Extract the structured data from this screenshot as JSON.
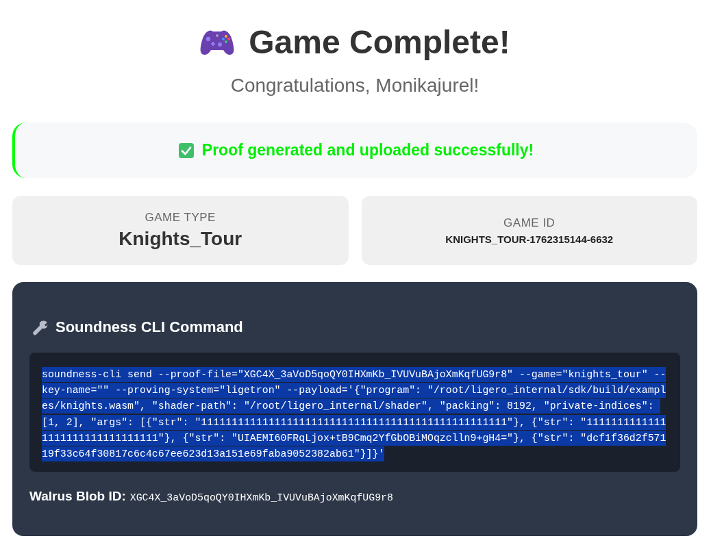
{
  "header": {
    "title": "Game Complete!",
    "subtitle": "Congratulations, Monikajurel!"
  },
  "status": {
    "kind": "success",
    "message": "Proof generated and uploaded successfully!"
  },
  "info_cards": [
    {
      "label": "GAME TYPE",
      "value": "Knights_Tour",
      "kind": "name"
    },
    {
      "label": "GAME ID",
      "value": "KNIGHTS_TOUR-1762315144-6632",
      "kind": "id"
    }
  ],
  "command_panel": {
    "title": "Soundness CLI Command",
    "command": {
      "text": "soundness-cli send --proof-file=\"XGC4X_3aVoD5qoQY0IHXmKb_IVUVuBAjoXmKqfUG9r8\" --game=\"knights_tour\" --key-name=\"\" --proving-system=\"ligetron\" --payload='{\"program\": \"/root/ligero_internal/sdk/build/examples/knights.wasm\", \"shader-path\": \"/root/ligero_internal/shader\", \"packing\": 8192, \"private-indices\": [1, 2], \"args\": [{\"str\": \"11111111111111111111111111111111111111111111111111\"}, {\"str\": \"11111111111111111111111111111111\"}, {\"str\": \"UIAEMI60FRqLjox+tB9Cmq2YfGbOBiMOqzclln9+gH4=\"}, {\"str\": \"dcf1f36d2f57119f33c64f30817c6c4c67ee623d13a151e69faba9052382ab61\"}]}'",
      "selected": true
    },
    "blob_id": {
      "label": "Walrus Blob ID:",
      "value": "XGC4X_3aVoD5qoQY0IHXmKb_IVUVuBAjoXmKqfUG9r8"
    }
  }
}
